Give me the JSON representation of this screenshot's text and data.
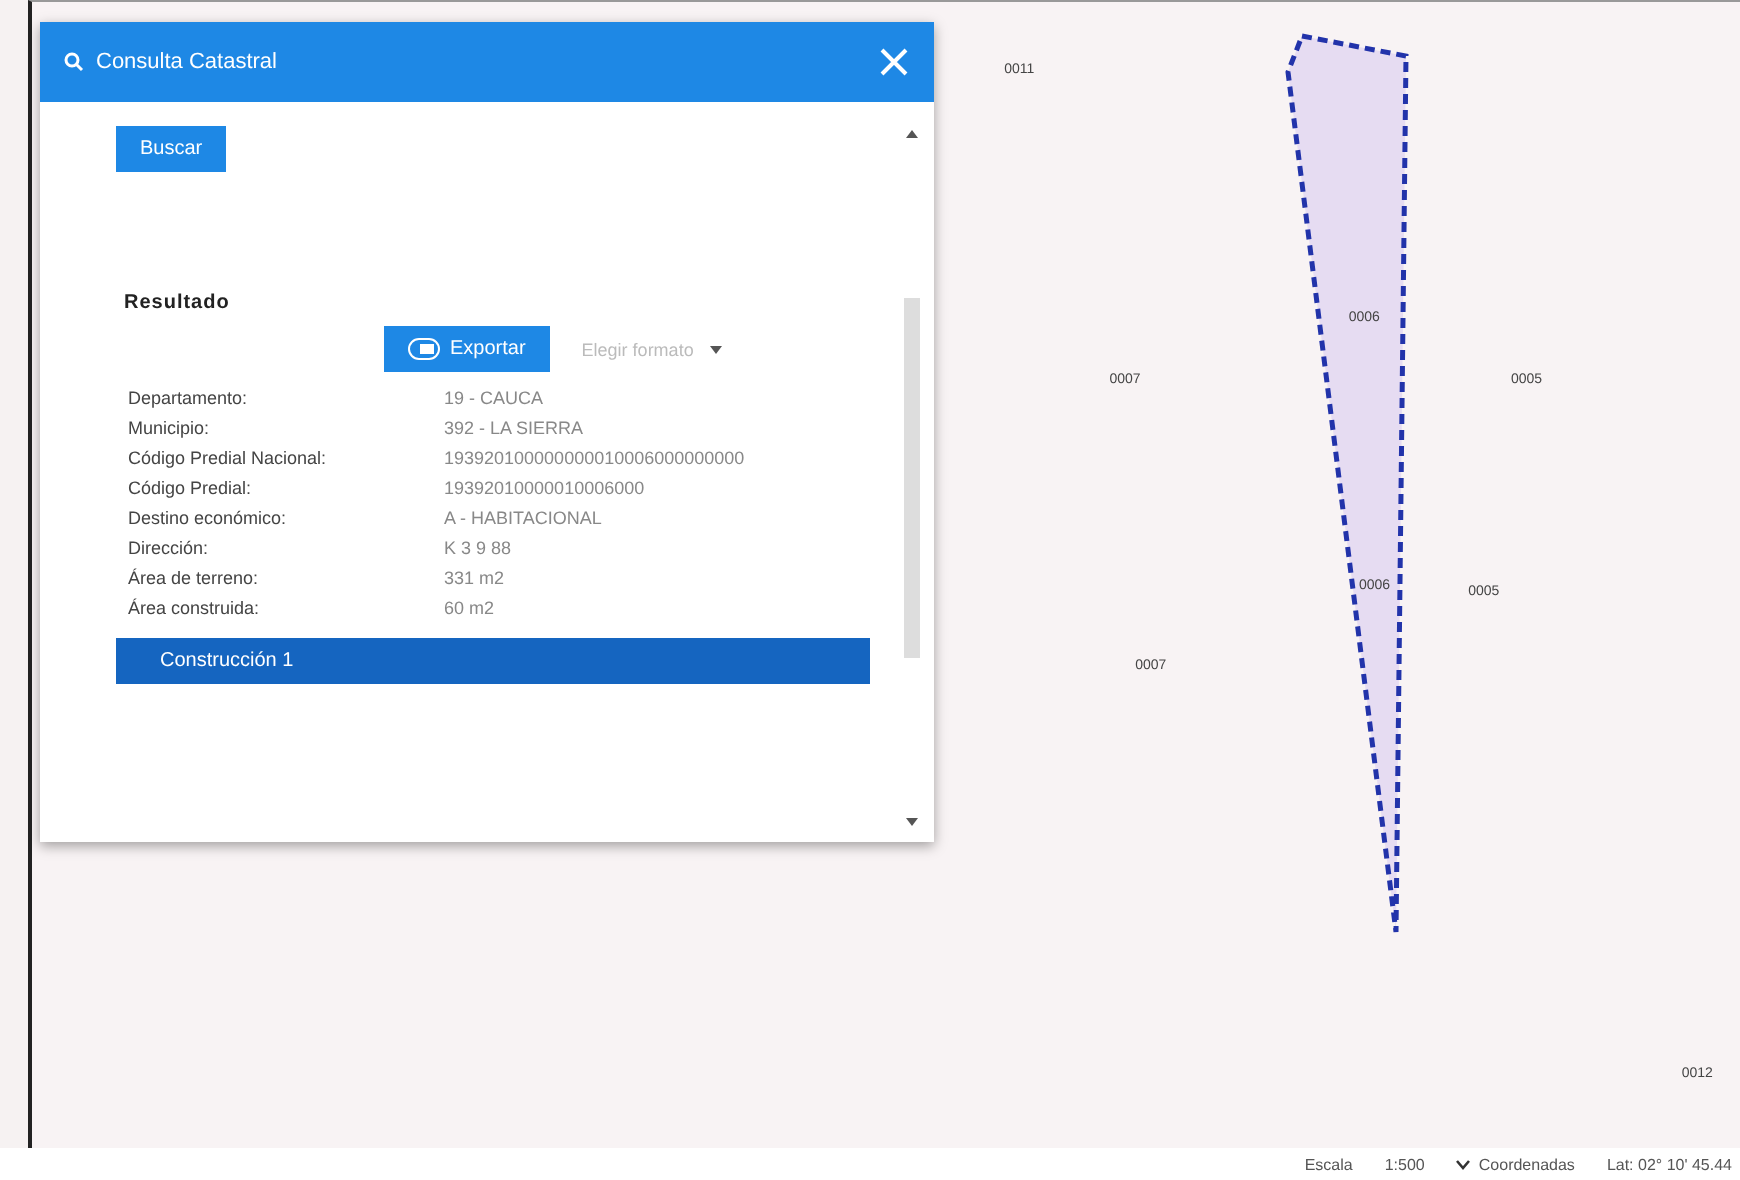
{
  "dialog": {
    "title": "Consulta Catastral",
    "search_button": "Buscar",
    "result_heading": "Resultado",
    "export_button": "Exportar",
    "format_select": {
      "placeholder": "Elegir formato"
    },
    "fields": [
      {
        "label": "Departamento:",
        "value": "19 - CAUCA"
      },
      {
        "label": "Municipio:",
        "value": "392 - LA SIERRA"
      },
      {
        "label": "Código Predial Nacional:",
        "value": "193920100000000010006000000000"
      },
      {
        "label": "Código Predial:",
        "value": "19392010000010006000"
      },
      {
        "label": "Destino económico:",
        "value": "A - HABITACIONAL"
      },
      {
        "label": "Dirección:",
        "value": "K 3 9 88"
      },
      {
        "label": "Área de terreno:",
        "value": "331 m2"
      },
      {
        "label": "Área construida:",
        "value": "60 m2"
      }
    ],
    "section": {
      "title": "Construcción 1"
    }
  },
  "map": {
    "labels": [
      "0011",
      "0007",
      "0006",
      "0005",
      "0006",
      "0005",
      "0007",
      "0012"
    ]
  },
  "status_bar": {
    "scale_label": "Escala",
    "scale_value": "1:500",
    "coords_label": "Coordenadas",
    "coords_value": "Lat: 02° 10' 45.44"
  }
}
